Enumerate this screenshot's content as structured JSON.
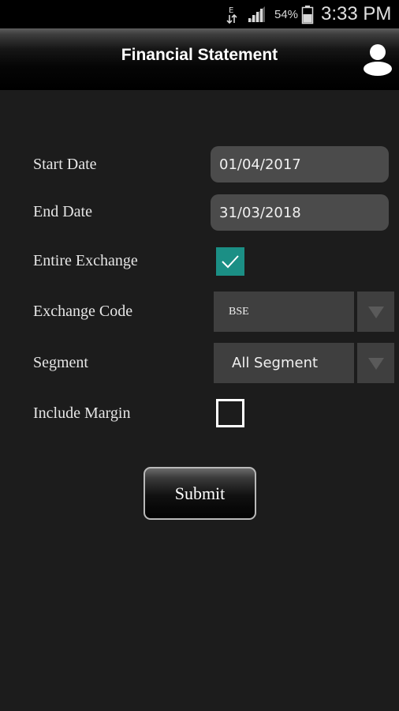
{
  "status_bar": {
    "battery_percent": "54%",
    "time": "3:33 PM",
    "icons": [
      "data-transfer-icon",
      "signal-icon",
      "battery-icon"
    ]
  },
  "app_bar": {
    "title": "Financial Statement",
    "profile_icon": "user-profile-icon"
  },
  "form": {
    "start_date": {
      "label": "Start Date",
      "value": "01/04/2017"
    },
    "end_date": {
      "label": "End Date",
      "value": "31/03/2018"
    },
    "entire_exchange": {
      "label": "Entire Exchange",
      "checked": true
    },
    "exchange_code": {
      "label": "Exchange Code",
      "selected": "BSE"
    },
    "segment": {
      "label": "Segment",
      "selected": "All Segment"
    },
    "include_margin": {
      "label": "Include Margin",
      "checked": false
    },
    "submit_label": "Submit"
  },
  "colors": {
    "background": "#1c1c1c",
    "field_background": "#4b4b4b",
    "checkbox_checked": "#1b8f85"
  }
}
